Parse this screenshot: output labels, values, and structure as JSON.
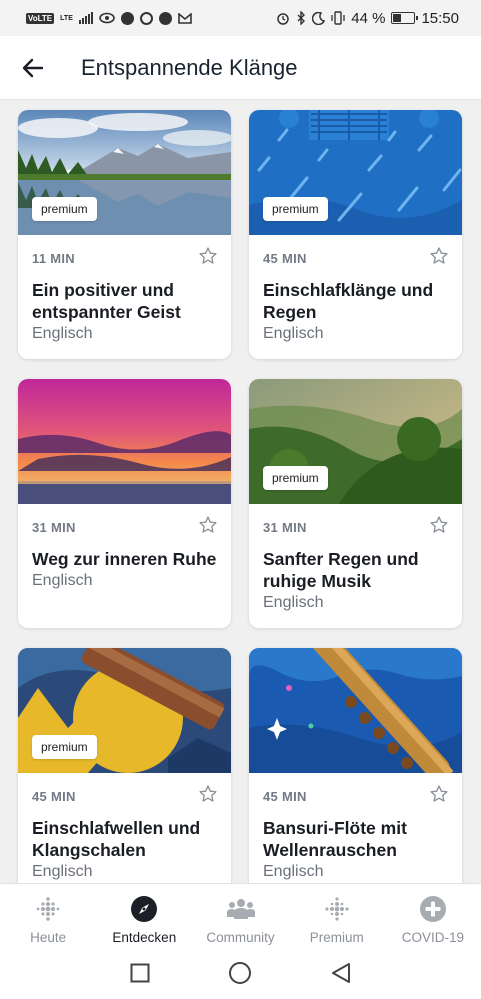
{
  "status_bar": {
    "left_badges": [
      "VoLTE",
      "LTE"
    ],
    "battery_text": "44 %",
    "battery_level": 0.44,
    "time": "15:50"
  },
  "header": {
    "back_icon": "arrow-left-icon",
    "title": "Entspannende Klänge"
  },
  "cards": [
    {
      "duration": "11 MIN",
      "title": "Ein positiver und entspannter Geist",
      "language": "Englisch",
      "badge": "premium",
      "image": "mountain-lake"
    },
    {
      "duration": "45 MIN",
      "title": "Einschlafklänge und Regen",
      "language": "Englisch",
      "badge": "premium",
      "image": "rain-window"
    },
    {
      "duration": "31 MIN",
      "title": "Weg zur inneren Ruhe",
      "language": "Englisch",
      "badge": "",
      "image": "sunset-sea"
    },
    {
      "duration": "31 MIN",
      "title": "Sanfter Regen und ruhige Musik",
      "language": "Englisch",
      "badge": "premium",
      "image": "green-valley"
    },
    {
      "duration": "45 MIN",
      "title": "Einschlafwellen und Klangschalen",
      "language": "Englisch",
      "badge": "premium",
      "image": "singing-bowl"
    },
    {
      "duration": "45 MIN",
      "title": "Bansuri-Flöte mit Wellenrauschen",
      "language": "Englisch",
      "badge": "",
      "image": "flute-sea"
    }
  ],
  "bottom_nav": [
    {
      "label": "Heute",
      "icon": "fitbit-dots-icon",
      "active": false
    },
    {
      "label": "Entdecken",
      "icon": "compass-icon",
      "active": true
    },
    {
      "label": "Community",
      "icon": "people-icon",
      "active": false
    },
    {
      "label": "Premium",
      "icon": "premium-dots-icon",
      "active": false
    },
    {
      "label": "COVID-19",
      "icon": "plus-circle-icon",
      "active": false
    }
  ],
  "system_nav": [
    "recents-square-icon",
    "home-circle-icon",
    "back-triangle-icon"
  ]
}
